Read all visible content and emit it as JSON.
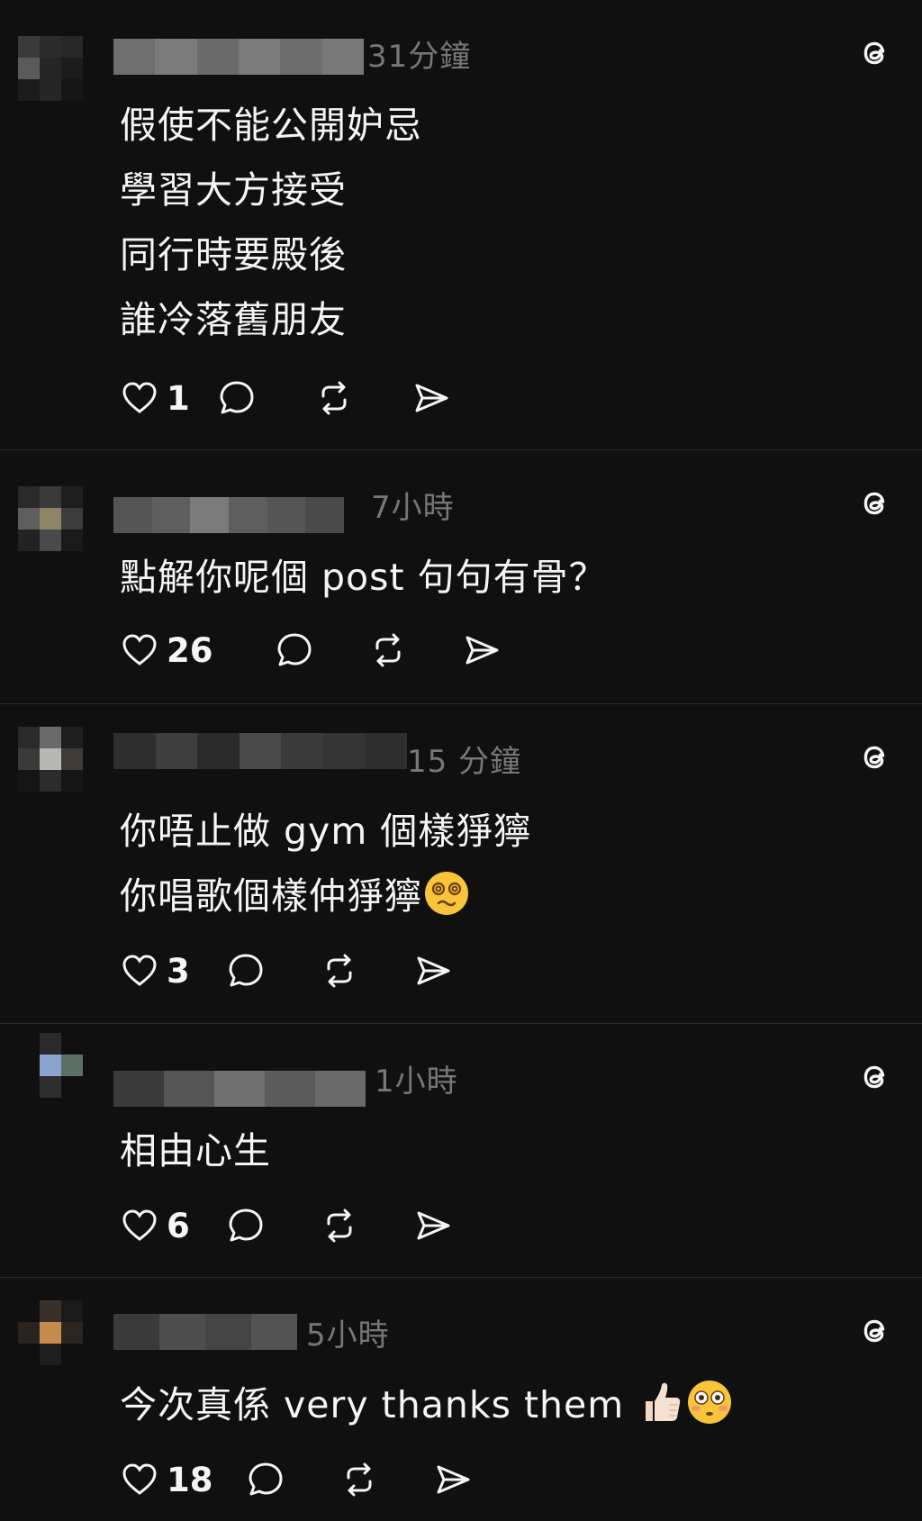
{
  "posts": [
    {
      "time": "31分鐘",
      "lines": [
        "假使不能公開妒忌",
        "學習大方接受",
        "同行時要殿後",
        "誰冷落舊朋友"
      ],
      "likes": "1"
    },
    {
      "time": "7小時",
      "lines": [
        "點解你呢個 post 句句有骨？"
      ],
      "likes": "26"
    },
    {
      "time": "15 分鐘",
      "lines": [
        "你唔止做 gym 個樣猙獰",
        "你唱歌個樣仲猙獰"
      ],
      "emoji_line2": "dizzy-face-emoji",
      "likes": "3"
    },
    {
      "time": "1小時",
      "lines": [
        "相由心生"
      ],
      "likes": "6"
    },
    {
      "time": "5小時",
      "lines": [
        "今次真係 very thanks them"
      ],
      "emoji_line1": [
        "thumbs-up-emoji",
        "flushed-face-emoji"
      ],
      "likes": "18"
    }
  ],
  "icons": {
    "like": "heart-icon",
    "reply": "comment-bubble-icon",
    "repost": "repost-icon",
    "share": "send-icon",
    "brand": "threads-logo-icon"
  },
  "colors": {
    "background": "#101010",
    "text": "#f3f5f7",
    "muted": "#777777",
    "divider": "#2a2a2a"
  }
}
